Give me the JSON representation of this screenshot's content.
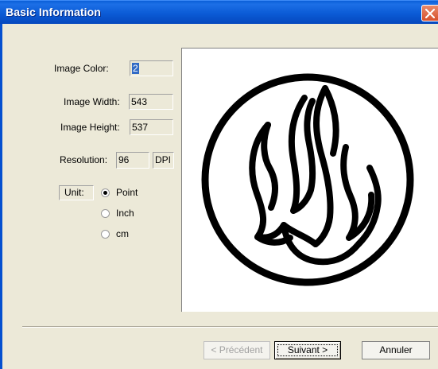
{
  "window": {
    "title": "Basic Information"
  },
  "fields": {
    "image_color_label": "Image Color:",
    "image_color_value": "2",
    "image_width_label": "Image Width:",
    "image_width_value": "543",
    "image_height_label": "Image Height:",
    "image_height_value": "537",
    "resolution_label": "Resolution:",
    "resolution_value": "96",
    "resolution_unit": "DPI"
  },
  "unit": {
    "label": "Unit:",
    "options": [
      "Point",
      "Inch",
      "cm"
    ],
    "selected": "Point"
  },
  "preview": {
    "description_icon": "flame-circle-logo"
  },
  "buttons": {
    "previous": "< Précédent",
    "next": "Suivant >",
    "cancel": "Annuler"
  },
  "colors": {
    "titlebar": "#0a5fd8",
    "close": "#d8502c",
    "dialog_bg": "#ece9d8",
    "selection": "#316ac5"
  }
}
